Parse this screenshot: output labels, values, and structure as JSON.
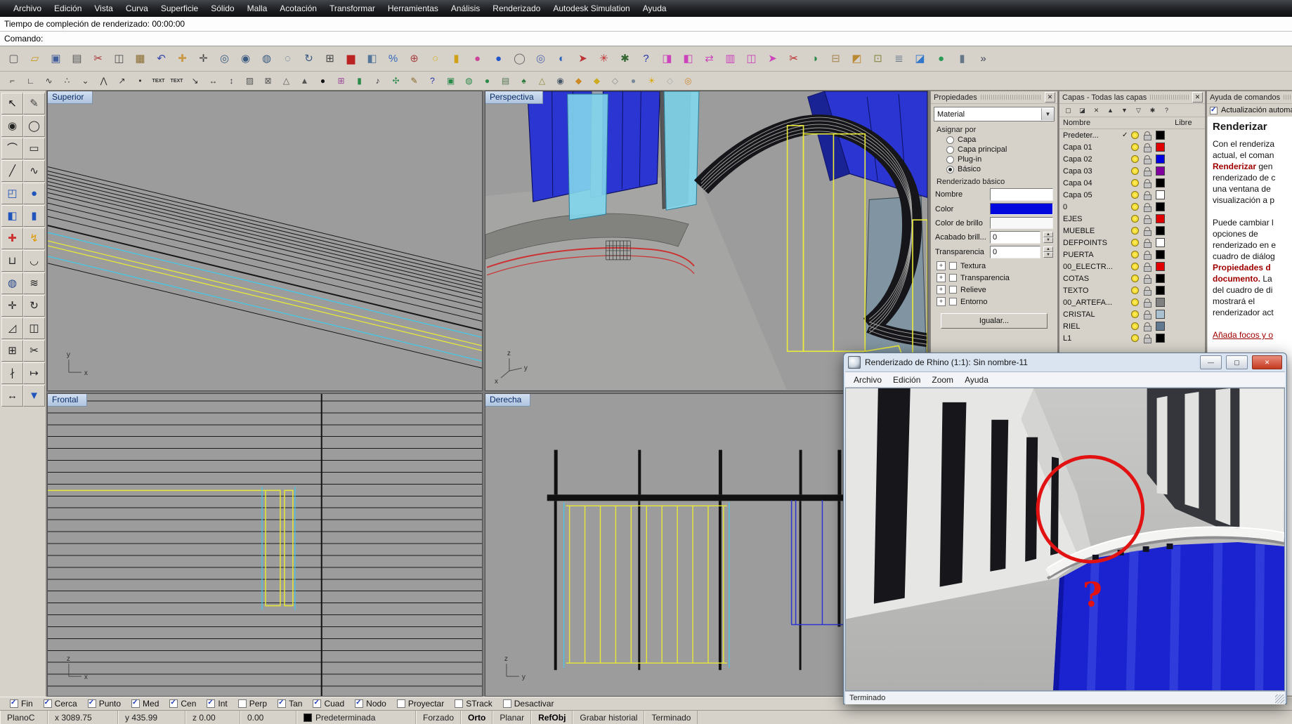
{
  "menubar": {
    "items": [
      "Archivo",
      "Edición",
      "Vista",
      "Curva",
      "Superficie",
      "Sólido",
      "Malla",
      "Acotación",
      "Transformar",
      "Herramientas",
      "Análisis",
      "Renderizado",
      "Autodesk Simulation",
      "Ayuda"
    ]
  },
  "command_area": {
    "history_line": "Tiempo de compleción de renderizado: 00:00:00",
    "prompt": "Comando:"
  },
  "ui": {
    "close": "✕",
    "arrow_down": "▼",
    "spin_up": "▲",
    "spin_down": "▼",
    "check": "✓",
    "plus": "+",
    "win_min": "—",
    "win_max": "▢",
    "win_close": "✕"
  },
  "toolbars": {
    "main": [
      {
        "name": "new-file-icon",
        "glyph": "▢",
        "color": "#5a5a5a"
      },
      {
        "name": "open-file-icon",
        "glyph": "▱",
        "color": "#c8961e"
      },
      {
        "name": "save-icon",
        "glyph": "▣",
        "color": "#44609c"
      },
      {
        "name": "print-icon",
        "glyph": "▤",
        "color": "#5a5a5a"
      },
      {
        "name": "cut-icon",
        "glyph": "✂",
        "color": "#aa3333"
      },
      {
        "name": "copy-icon",
        "glyph": "◫",
        "color": "#555555"
      },
      {
        "name": "paste-icon",
        "glyph": "▦",
        "color": "#8a6a2e"
      },
      {
        "name": "undo-icon",
        "glyph": "↶",
        "color": "#3344aa"
      },
      {
        "name": "pan-hand-icon",
        "glyph": "✚",
        "color": "#c89a4a"
      },
      {
        "name": "move-icon",
        "glyph": "✛",
        "color": "#444444"
      },
      {
        "name": "zoom-dynamic-icon",
        "glyph": "◎",
        "color": "#3a5a80"
      },
      {
        "name": "zoom-window-icon",
        "glyph": "◉",
        "color": "#3a5a80"
      },
      {
        "name": "zoom-extents-icon",
        "glyph": "◍",
        "color": "#3a5a80"
      },
      {
        "name": "zoom-selected-icon",
        "glyph": "◌",
        "color": "#3a5a80"
      },
      {
        "name": "rotate-view-icon",
        "glyph": "↻",
        "color": "#3a5a80"
      },
      {
        "name": "grid-table-icon",
        "glyph": "⊞",
        "color": "#444444"
      },
      {
        "name": "car-view-icon",
        "glyph": "▆",
        "color": "#bb2222"
      },
      {
        "name": "shaded-view-icon",
        "glyph": "◧",
        "color": "#557799"
      },
      {
        "name": "percent-scale-icon",
        "glyph": "%",
        "color": "#3366bb"
      },
      {
        "name": "cplane-target-icon",
        "glyph": "⊕",
        "color": "#aa4444"
      },
      {
        "name": "light-bulb-icon",
        "glyph": "○",
        "color": "#d8b020"
      },
      {
        "name": "lock-toggle-icon",
        "glyph": "▮",
        "color": "#d0a018"
      },
      {
        "name": "render-sphere-icon",
        "glyph": "●",
        "color": "#cc4499"
      },
      {
        "name": "render-blue-sphere-icon",
        "glyph": "●",
        "color": "#2255cc"
      },
      {
        "name": "circle-ring-icon",
        "glyph": "◯",
        "color": "#666666"
      },
      {
        "name": "torus-icon",
        "glyph": "◎",
        "color": "#5566aa"
      },
      {
        "name": "globe-view-icon",
        "glyph": "◐",
        "color": "#2a66b8"
      },
      {
        "name": "flag-tool-icon",
        "glyph": "➤",
        "color": "#bb3333"
      },
      {
        "name": "gear-settings-icon",
        "glyph": "✳",
        "color": "#bb3333"
      },
      {
        "name": "analyze-tool-icon",
        "glyph": "✱",
        "color": "#336633"
      },
      {
        "name": "help-icon",
        "glyph": "?",
        "color": "#2233aa"
      },
      {
        "name": "hide-object-icon",
        "glyph": "◨",
        "color": "#cc44bb"
      },
      {
        "name": "show-object-icon",
        "glyph": "◧",
        "color": "#cc44bb"
      },
      {
        "name": "swap-objects-icon",
        "glyph": "⇄",
        "color": "#cc44bb"
      },
      {
        "name": "isolate-panel-icon",
        "glyph": "▥",
        "color": "#cc44bb"
      },
      {
        "name": "mirror-panel-icon",
        "glyph": "◫",
        "color": "#cc44bb"
      },
      {
        "name": "arrow-tool-icon",
        "glyph": "➤",
        "color": "#cc44bb"
      },
      {
        "name": "cut-red-icon",
        "glyph": "✂",
        "color": "#bb2222"
      },
      {
        "name": "world-globe-icon",
        "glyph": "◑",
        "color": "#2a8a4a"
      },
      {
        "name": "group-boxes-icon",
        "glyph": "⊟",
        "color": "#aa8855"
      },
      {
        "name": "color-palette-icon",
        "glyph": "◩",
        "color": "#bb8833"
      },
      {
        "name": "block-insert-icon",
        "glyph": "⊡",
        "color": "#888844"
      },
      {
        "name": "stack-layers-icon",
        "glyph": "≣",
        "color": "#667788"
      },
      {
        "name": "blue-cube-icon",
        "glyph": "◪",
        "color": "#3377cc"
      },
      {
        "name": "green-sphere-icon",
        "glyph": "●",
        "color": "#2a9a55"
      },
      {
        "name": "cylinder-tool-icon",
        "glyph": "▮",
        "color": "#667788"
      },
      {
        "name": "more-tools-icon",
        "glyph": "»",
        "color": "#444455"
      }
    ],
    "secondary": [
      {
        "name": "corner-snap-icon",
        "glyph": "⌐",
        "color": "#333333"
      },
      {
        "name": "angle-snap-icon",
        "glyph": "∟",
        "color": "#333333"
      },
      {
        "name": "curve-edit-icon",
        "glyph": "∿",
        "color": "#333333"
      },
      {
        "name": "points-edit-icon",
        "glyph": "∴",
        "color": "#333333"
      },
      {
        "name": "kink-tool-icon",
        "glyph": "⌄",
        "color": "#333333"
      },
      {
        "name": "handle-tool-icon",
        "glyph": "⋀",
        "color": "#333333"
      },
      {
        "name": "node-move-icon",
        "glyph": "↗",
        "color": "#333333"
      },
      {
        "name": "control-point-icon",
        "glyph": "•",
        "color": "#333333"
      },
      {
        "name": "text-tool-icon",
        "glyph": "TEXT",
        "color": "#333333",
        "text": true
      },
      {
        "name": "text-style-icon",
        "glyph": "TEXT",
        "color": "#333333",
        "text": true
      },
      {
        "name": "leader-tool-icon",
        "glyph": "↘",
        "color": "#333333"
      },
      {
        "name": "dim-horizontal-icon",
        "glyph": "↔",
        "color": "#333333"
      },
      {
        "name": "dim-vertical-icon",
        "glyph": "↕",
        "color": "#333333"
      },
      {
        "name": "hatch-tool-icon",
        "glyph": "▨",
        "color": "#555555"
      },
      {
        "name": "box-edit-icon",
        "glyph": "⊠",
        "color": "#555555"
      },
      {
        "name": "area-tool-icon",
        "glyph": "△",
        "color": "#555555"
      },
      {
        "name": "volume-tool-icon",
        "glyph": "▲",
        "color": "#555555"
      },
      {
        "name": "stopwatch-icon",
        "glyph": "●",
        "color": "#111111"
      },
      {
        "name": "gift-tool-icon",
        "glyph": "⊞",
        "color": "#994499"
      },
      {
        "name": "bottle-green-icon",
        "glyph": "▮",
        "color": "#2a8a4a"
      },
      {
        "name": "note-tool-icon",
        "glyph": "♪",
        "color": "#333333"
      },
      {
        "name": "clover-tool-icon",
        "glyph": "✣",
        "color": "#2a8a4a"
      },
      {
        "name": "pencil-edit-icon",
        "glyph": "✎",
        "color": "#886622"
      },
      {
        "name": "question-blue-icon",
        "glyph": "?",
        "color": "#2233aa"
      },
      {
        "name": "image-frame-icon",
        "glyph": "▣",
        "color": "#2a8a4a"
      },
      {
        "name": "globe-green-icon",
        "glyph": "◍",
        "color": "#2a8a4a"
      },
      {
        "name": "sphere-green-icon",
        "glyph": "●",
        "color": "#2a8a4a"
      },
      {
        "name": "photo-tool-icon",
        "glyph": "▤",
        "color": "#557755"
      },
      {
        "name": "tree-tool-icon",
        "glyph": "♠",
        "color": "#2a7a3a"
      },
      {
        "name": "lamp-tool-icon",
        "glyph": "△",
        "color": "#888833"
      },
      {
        "name": "loupe-tool-icon",
        "glyph": "◉",
        "color": "#445566"
      },
      {
        "name": "diamond-orange-icon",
        "glyph": "◆",
        "color": "#cc8822"
      },
      {
        "name": "diamond-yellow-icon",
        "glyph": "◆",
        "color": "#ccaa22"
      },
      {
        "name": "diamond-white-icon",
        "glyph": "◇",
        "color": "#888888"
      },
      {
        "name": "sphere-gray-icon",
        "glyph": "●",
        "color": "#778899"
      },
      {
        "name": "sun-tool-icon",
        "glyph": "☀",
        "color": "#ddaa00"
      },
      {
        "name": "diamond-pale-icon",
        "glyph": "◇",
        "color": "#aaaaaa"
      },
      {
        "name": "check-circle-icon",
        "glyph": "◎",
        "color": "#cc8833"
      }
    ],
    "left": [
      {
        "name": "select-arrow-icon",
        "glyph": "↖",
        "color": "#111111"
      },
      {
        "name": "selection-brush-icon",
        "glyph": "✎",
        "color": "#444444"
      },
      {
        "name": "point-tool-icon",
        "glyph": "◉",
        "color": "#222222"
      },
      {
        "name": "circle-tool-icon",
        "glyph": "◯",
        "color": "#222222"
      },
      {
        "name": "arc-tool-icon",
        "glyph": "⌒",
        "color": "#222222"
      },
      {
        "name": "rectangle-tool-icon",
        "glyph": "▭",
        "color": "#222222"
      },
      {
        "name": "line-tool-icon",
        "glyph": "╱",
        "color": "#222222"
      },
      {
        "name": "curve-tool-icon",
        "glyph": "∿",
        "color": "#222222"
      },
      {
        "name": "surface-tool-icon",
        "glyph": "◰",
        "color": "#2255bb"
      },
      {
        "name": "sphere-tool-icon",
        "glyph": "●",
        "color": "#2255bb"
      },
      {
        "name": "box-tool-icon",
        "glyph": "◧",
        "color": "#2255bb"
      },
      {
        "name": "cylinder-solid-icon",
        "glyph": "▮",
        "color": "#2255bb"
      },
      {
        "name": "magnet-tool-icon",
        "glyph": "✚",
        "color": "#cc3333"
      },
      {
        "name": "lightning-tool-icon",
        "glyph": "↯",
        "color": "#dd9900"
      },
      {
        "name": "join-tool-icon",
        "glyph": "⊔",
        "color": "#222222"
      },
      {
        "name": "fillet-tool-icon",
        "glyph": "◡",
        "color": "#222222"
      },
      {
        "name": "boolean-tool-icon",
        "glyph": "◍",
        "color": "#224488"
      },
      {
        "name": "offset-tool-icon",
        "glyph": "≋",
        "color": "#222222"
      },
      {
        "name": "move-tool-icon",
        "glyph": "✛",
        "color": "#222222"
      },
      {
        "name": "rotate-tool-icon",
        "glyph": "↻",
        "color": "#222222"
      },
      {
        "name": "scale-tool-icon",
        "glyph": "◿",
        "color": "#222222"
      },
      {
        "name": "mirror-tool-icon",
        "glyph": "◫",
        "color": "#222222"
      },
      {
        "name": "array-tool-icon",
        "glyph": "⊞",
        "color": "#222222"
      },
      {
        "name": "trim-tool-icon",
        "glyph": "✂",
        "color": "#222222"
      },
      {
        "name": "split-tool-icon",
        "glyph": "∤",
        "color": "#222222"
      },
      {
        "name": "extend-tool-icon",
        "glyph": "↦",
        "color": "#222222"
      },
      {
        "name": "dimension-tool-icon",
        "glyph": "↔",
        "color": "#222222"
      },
      {
        "name": "drape-tool-icon",
        "glyph": "▼",
        "color": "#2255bb"
      }
    ]
  },
  "viewports": {
    "superior": {
      "label": "Superior",
      "axis_v": "y",
      "axis_h": "x"
    },
    "perspectiva": {
      "label": "Perspectiva",
      "axis_v": "z",
      "axis_h": "y",
      "axis_d": "x"
    },
    "frontal": {
      "label": "Frontal",
      "axis_v": "z",
      "axis_h": "x"
    },
    "derecha": {
      "label": "Derecha",
      "axis_v": "z",
      "axis_h": "y"
    }
  },
  "properties_panel": {
    "title": "Propiedades",
    "material_value": "Material",
    "assign_by_label": "Asignar por",
    "assign_options": [
      {
        "label": "Capa",
        "selected": false
      },
      {
        "label": "Capa principal",
        "selected": false
      },
      {
        "label": "Plug-in",
        "selected": false
      },
      {
        "label": "Básico",
        "selected": true
      }
    ],
    "section_basic": "Renderizado básico",
    "name_label": "Nombre",
    "name_value": "",
    "color_label": "Color",
    "color_value": "#0008dd",
    "gloss_color_label": "Color de brillo",
    "gloss_color_value": "#f8f8f8",
    "gloss_label": "Acabado brill...",
    "gloss_value": "0",
    "transparency_label": "Transparencia",
    "transparency_value": "0",
    "expand_rows": [
      {
        "label": "Textura"
      },
      {
        "label": "Transparencia"
      },
      {
        "label": "Relieve"
      },
      {
        "label": "Entorno"
      }
    ],
    "match_button": "Igualar..."
  },
  "layers_panel": {
    "title": "Capas - Todas las capas",
    "toolbar": [
      {
        "name": "new-layer-icon",
        "glyph": "▢"
      },
      {
        "name": "new-sublayer-icon",
        "glyph": "◪"
      },
      {
        "name": "delete-layer-icon",
        "glyph": "✕"
      },
      {
        "name": "move-up-icon",
        "glyph": "▲"
      },
      {
        "name": "move-down-icon",
        "glyph": "▼"
      },
      {
        "name": "filter-funnel-icon",
        "glyph": "▽"
      },
      {
        "name": "layer-tools-icon",
        "glyph": "✱"
      },
      {
        "name": "layer-help-icon",
        "glyph": "?"
      }
    ],
    "col_name": "Nombre",
    "col_free": "Libre",
    "rows": [
      {
        "name": "Predeter...",
        "current": true,
        "color": "#000000"
      },
      {
        "name": "Capa 01",
        "current": false,
        "color": "#e00000"
      },
      {
        "name": "Capa 02",
        "current": false,
        "color": "#0000e0"
      },
      {
        "name": "Capa 03",
        "current": false,
        "color": "#8000a0"
      },
      {
        "name": "Capa 04",
        "current": false,
        "color": "#000000"
      },
      {
        "name": "Capa 05",
        "current": false,
        "color": "#ffffff"
      },
      {
        "name": "0",
        "current": false,
        "color": "#000000"
      },
      {
        "name": "EJES",
        "current": false,
        "color": "#e00000"
      },
      {
        "name": "MUEBLE",
        "current": false,
        "color": "#000000"
      },
      {
        "name": "DEFPOINTS",
        "current": false,
        "color": "#ffffff"
      },
      {
        "name": "PUERTA",
        "current": false,
        "color": "#000000"
      },
      {
        "name": "00_ELECTR...",
        "current": false,
        "color": "#e00000"
      },
      {
        "name": "COTAS",
        "current": false,
        "color": "#000000"
      },
      {
        "name": "TEXTO",
        "current": false,
        "color": "#000000"
      },
      {
        "name": "00_ARTEFA...",
        "current": false,
        "color": "#808080"
      },
      {
        "name": "CRISTAL",
        "current": false,
        "color": "#a8c0d0"
      },
      {
        "name": "RIEL",
        "current": false,
        "color": "#607890"
      },
      {
        "name": "L1",
        "current": false,
        "color": "#000000"
      }
    ]
  },
  "help_panel": {
    "title": "Ayuda de comandos",
    "auto_update_label": "Actualización automática",
    "auto_update_checked": true,
    "heading": "Renderizar",
    "lines": [
      {
        "text": "Con el renderiza"
      },
      {
        "text": "actual, el coman"
      },
      {
        "red": "Renderizar",
        "text": " gen"
      },
      {
        "text": "renderizado de c"
      },
      {
        "text": "una ventana de"
      },
      {
        "text": "visualización a p"
      },
      {
        "text": ""
      },
      {
        "text": "Puede cambiar l"
      },
      {
        "text": "opciones de"
      },
      {
        "text": "renderizado en e"
      },
      {
        "text": "cuadro de diálog"
      },
      {
        "red": "Propiedades d",
        "text": ""
      },
      {
        "red": "documento.",
        "text": " La"
      },
      {
        "text": "del cuadro de di"
      },
      {
        "text": "mostrará el"
      },
      {
        "text": "renderizador act"
      },
      {
        "text": ""
      },
      {
        "red": "Añada focos y o",
        "text": "",
        "link": true
      }
    ]
  },
  "render_window": {
    "title": "Renderizado de Rhino (1:1): Sin nombre-11",
    "menu": [
      "Archivo",
      "Edición",
      "Zoom",
      "Ayuda"
    ],
    "status": "Terminado",
    "annotation": "?"
  },
  "osnap_bar": {
    "items": [
      {
        "label": "Fin",
        "checked": true
      },
      {
        "label": "Cerca",
        "checked": true
      },
      {
        "label": "Punto",
        "checked": true
      },
      {
        "label": "Med",
        "checked": true
      },
      {
        "label": "Cen",
        "checked": true
      },
      {
        "label": "Int",
        "checked": true
      },
      {
        "label": "Perp",
        "checked": false
      },
      {
        "label": "Tan",
        "checked": true
      },
      {
        "label": "Cuad",
        "checked": true
      },
      {
        "label": "Nodo",
        "checked": true
      },
      {
        "label": "Proyectar",
        "checked": false
      },
      {
        "label": "STrack",
        "checked": false
      },
      {
        "label": "Desactivar",
        "checked": false
      }
    ]
  },
  "status_bar": {
    "cplane": "PlanoC",
    "x": "x 3089.75",
    "y": "y 435.99",
    "z": "z 0.00",
    "delta": "0.00",
    "layer": "Predeterminada",
    "layer_color": "#000000",
    "toggles": [
      {
        "label": "Forzado",
        "active": false
      },
      {
        "label": "Orto",
        "active": true
      },
      {
        "label": "Planar",
        "active": false
      },
      {
        "label": "RefObj",
        "active": true
      },
      {
        "label": "Grabar historial",
        "active": false
      },
      {
        "label": "Terminado",
        "active": false
      }
    ]
  }
}
